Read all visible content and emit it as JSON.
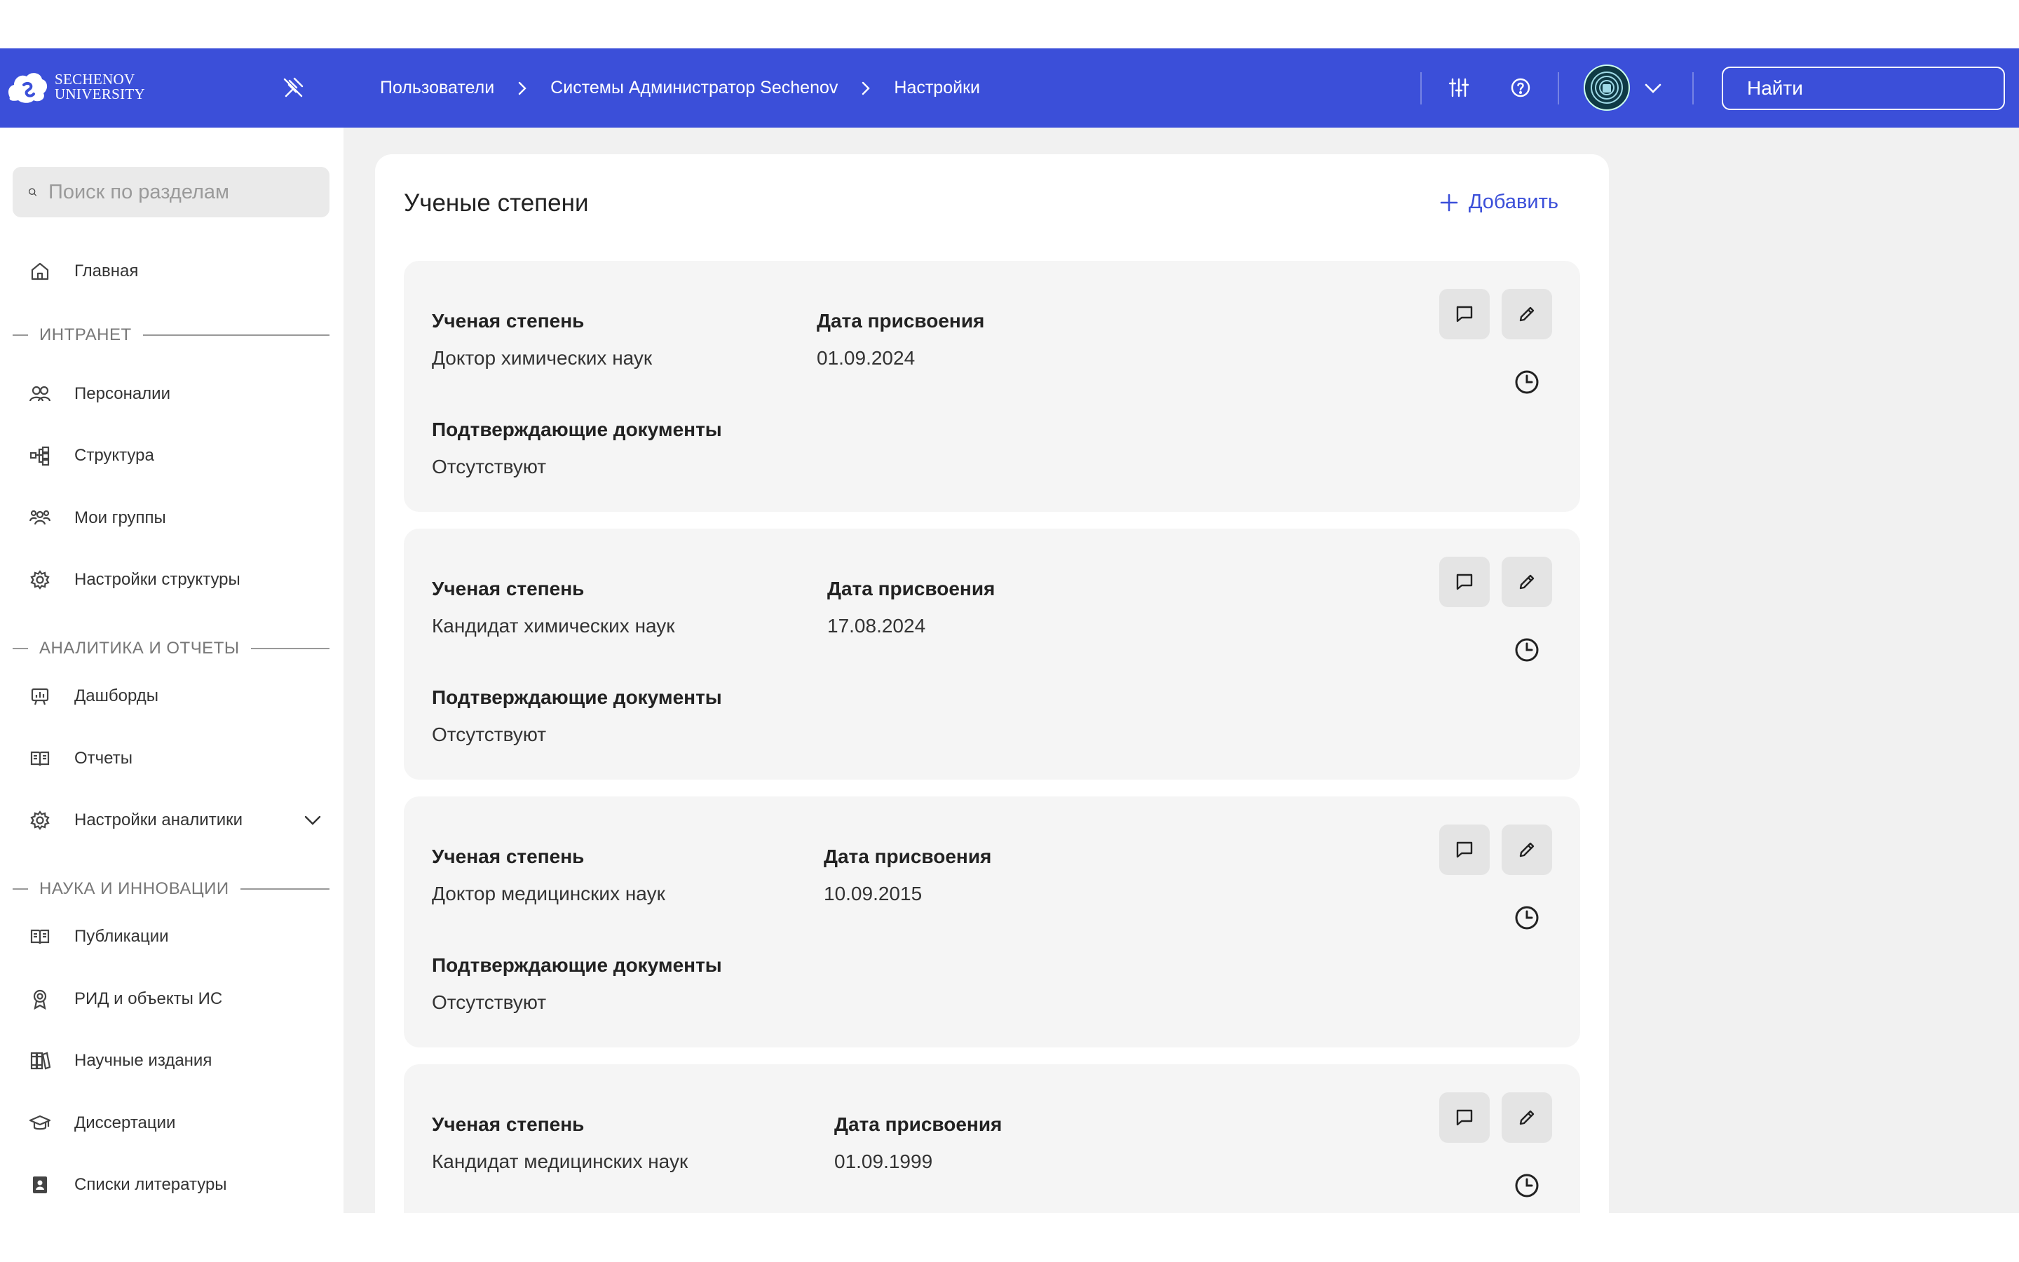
{
  "header": {
    "logo_line1": "SECHENOV",
    "logo_line2": "UNIVERSITY",
    "breadcrumbs": [
      "Пользователи",
      "Системы Администратор Sechenov",
      "Настройки"
    ],
    "search_placeholder": "Найти"
  },
  "sidebar": {
    "search_placeholder": "Поиск по разделам",
    "home": "Главная",
    "sections": [
      "ИНТРАНЕТ",
      "АНАЛИТИКА И ОТЧЕТЫ",
      "НАУКА И ИННОВАЦИИ"
    ],
    "items": [
      {
        "label": "Персоналии",
        "icon": "people-icon"
      },
      {
        "label": "Структура",
        "icon": "structure-icon"
      },
      {
        "label": "Мои группы",
        "icon": "groups-icon"
      },
      {
        "label": "Настройки структуры",
        "icon": "gear-icon"
      },
      {
        "label": "Дашборды",
        "icon": "dashboard-icon"
      },
      {
        "label": "Отчеты",
        "icon": "book-icon"
      },
      {
        "label": "Настройки аналитики",
        "icon": "gear-icon"
      },
      {
        "label": "Публикации",
        "icon": "book-icon"
      },
      {
        "label": "РИД и объекты ИС",
        "icon": "award-icon"
      },
      {
        "label": "Научные издания",
        "icon": "books-icon"
      },
      {
        "label": "Диссертации",
        "icon": "graduation-cap-icon"
      },
      {
        "label": "Списки литературы",
        "icon": "contacts-book-icon"
      }
    ]
  },
  "main": {
    "title": "Ученые степени",
    "add_label": "Добавить",
    "degree_label": "Ученая степень",
    "date_label": "Дата присвоения",
    "docs_label": "Подтверждающие документы",
    "cards": [
      {
        "degree": "Доктор химических наук",
        "date": "01.09.2024",
        "docs": "Отсутствуют"
      },
      {
        "degree": "Кандидат химических наук",
        "date": "17.08.2024",
        "docs": "Отсутствуют"
      },
      {
        "degree": "Доктор медицинских наук",
        "date": "10.09.2015",
        "docs": "Отсутствуют"
      },
      {
        "degree": "Кандидат медицинских наук",
        "date": "01.09.1999",
        "docs": ""
      }
    ]
  },
  "colors": {
    "accent": "#3b4fd9",
    "background": "#f1f1f1",
    "card": "#f5f5f5"
  }
}
